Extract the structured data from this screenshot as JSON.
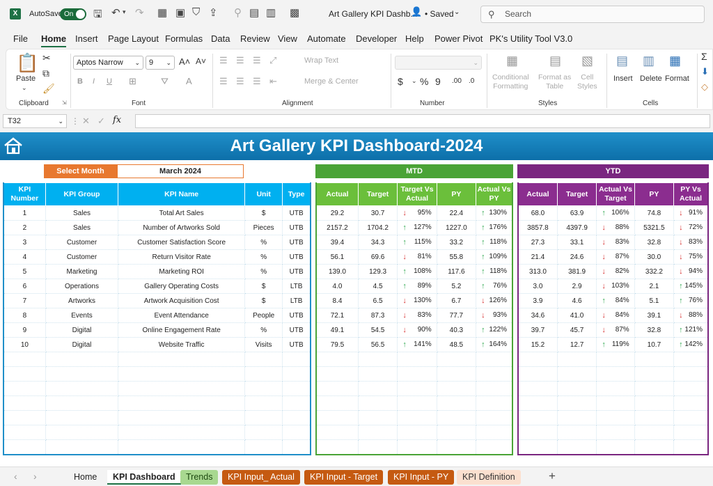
{
  "titlebar": {
    "autosave_label": "AutoSave",
    "toggle_label": "On",
    "doc_title": "Art Gallery KPI Dashb...",
    "saved_label": "• Saved",
    "search_placeholder": "Search"
  },
  "menu": [
    "File",
    "Home",
    "Insert",
    "Page Layout",
    "Formulas",
    "Data",
    "Review",
    "View",
    "Automate",
    "Developer",
    "Help",
    "Power Pivot",
    "PK's Utility Tool V3.0"
  ],
  "ribbon": {
    "paste": "Paste",
    "clipboard": "Clipboard",
    "font_name": "Aptos Narrow",
    "font_size": "9",
    "font": "Font",
    "wrap_text": "Wrap Text",
    "merge_center": "Merge & Center",
    "alignment": "Alignment",
    "number": "Number",
    "conditional_formatting": [
      "Conditional",
      "Formatting"
    ],
    "format_as_table": [
      "Format as",
      "Table"
    ],
    "cell_styles": [
      "Cell",
      "Styles"
    ],
    "styles": "Styles",
    "insert": "Insert",
    "delete": "Delete",
    "format": "Format",
    "cells": "Cells"
  },
  "formula_bar": {
    "name_box": "T32",
    "fx": "fx"
  },
  "dashboard": {
    "title": "Art Gallery KPI Dashboard-2024",
    "select_month_label": "Select Month",
    "month": "March 2024",
    "mtd_label": "MTD",
    "ytd_label": "YTD",
    "kpi_headers": [
      "KPI Number",
      "KPI Group",
      "KPI Name",
      "Unit",
      "Type"
    ],
    "mtd_headers": [
      "Actual",
      "Target",
      "Target Vs Actual",
      "PY",
      "Actual Vs PY"
    ],
    "ytd_headers": [
      "Actual",
      "Target",
      "Actual Vs Target",
      "PY",
      "PY Vs Actual"
    ],
    "rows": [
      {
        "n": "1",
        "group": "Sales",
        "name": "Total Art Sales",
        "unit": "$",
        "type": "UTB",
        "m": [
          "29.2",
          "30.7",
          "down",
          "95%",
          "22.4",
          "up",
          "130%"
        ],
        "y": [
          "68.0",
          "63.9",
          "up",
          "106%",
          "74.8",
          "down",
          "91%"
        ]
      },
      {
        "n": "2",
        "group": "Sales",
        "name": "Number of Artworks Sold",
        "unit": "Pieces",
        "type": "UTB",
        "m": [
          "2157.2",
          "1704.2",
          "up",
          "127%",
          "1227.0",
          "up",
          "176%"
        ],
        "y": [
          "3857.8",
          "4397.9",
          "down",
          "88%",
          "5321.5",
          "down",
          "72%"
        ]
      },
      {
        "n": "3",
        "group": "Customer",
        "name": "Customer Satisfaction Score",
        "unit": "%",
        "type": "UTB",
        "m": [
          "39.4",
          "34.3",
          "up",
          "115%",
          "33.2",
          "up",
          "118%"
        ],
        "y": [
          "27.3",
          "33.1",
          "down",
          "83%",
          "32.8",
          "down",
          "83%"
        ]
      },
      {
        "n": "4",
        "group": "Customer",
        "name": "Return Visitor Rate",
        "unit": "%",
        "type": "UTB",
        "m": [
          "56.1",
          "69.6",
          "down",
          "81%",
          "55.8",
          "up",
          "109%"
        ],
        "y": [
          "21.4",
          "24.6",
          "down",
          "87%",
          "30.0",
          "down",
          "75%"
        ]
      },
      {
        "n": "5",
        "group": "Marketing",
        "name": "Marketing ROI",
        "unit": "%",
        "type": "UTB",
        "m": [
          "139.0",
          "129.3",
          "up",
          "108%",
          "117.6",
          "up",
          "118%"
        ],
        "y": [
          "313.0",
          "381.9",
          "down",
          "82%",
          "332.2",
          "down",
          "94%"
        ]
      },
      {
        "n": "6",
        "group": "Operations",
        "name": "Gallery Operating Costs",
        "unit": "$",
        "type": "LTB",
        "m": [
          "4.0",
          "4.5",
          "up",
          "89%",
          "5.2",
          "up",
          "76%"
        ],
        "y": [
          "3.0",
          "2.9",
          "down",
          "103%",
          "2.1",
          "up",
          "145%"
        ]
      },
      {
        "n": "7",
        "group": "Artworks",
        "name": "Artwork Acquisition Cost",
        "unit": "$",
        "type": "LTB",
        "m": [
          "8.4",
          "6.5",
          "down",
          "130%",
          "6.7",
          "down",
          "126%"
        ],
        "y": [
          "3.9",
          "4.6",
          "up",
          "84%",
          "5.1",
          "up",
          "76%"
        ]
      },
      {
        "n": "8",
        "group": "Events",
        "name": "Event Attendance",
        "unit": "People",
        "type": "UTB",
        "m": [
          "72.1",
          "87.3",
          "down",
          "83%",
          "77.7",
          "down",
          "93%"
        ],
        "y": [
          "34.6",
          "41.0",
          "down",
          "84%",
          "39.1",
          "down",
          "88%"
        ]
      },
      {
        "n": "9",
        "group": "Digital",
        "name": "Online Engagement Rate",
        "unit": "%",
        "type": "UTB",
        "m": [
          "49.1",
          "54.5",
          "down",
          "90%",
          "40.3",
          "up",
          "122%"
        ],
        "y": [
          "39.7",
          "45.7",
          "down",
          "87%",
          "32.8",
          "up",
          "121%"
        ]
      },
      {
        "n": "10",
        "group": "Digital",
        "name": "Website Traffic",
        "unit": "Visits",
        "type": "UTB",
        "m": [
          "79.5",
          "56.5",
          "up",
          "141%",
          "48.5",
          "up",
          "164%"
        ],
        "y": [
          "15.2",
          "12.7",
          "up",
          "119%",
          "10.7",
          "up",
          "142%"
        ]
      }
    ]
  },
  "tabs": [
    "Home",
    "KPI Dashboard",
    "Trends",
    "KPI Input_ Actual",
    "KPI Input - Target",
    "KPI Input - PY",
    "KPI Definition"
  ],
  "colors": {
    "excel_green": "#1e7145",
    "banner": "#1f8fc9",
    "kpi_header": "#00b0f0",
    "mtd": "#4aa336",
    "ytd": "#7a2680",
    "select_month": "#e8782f",
    "up": "#2fa84f",
    "down": "#d62b2b"
  }
}
